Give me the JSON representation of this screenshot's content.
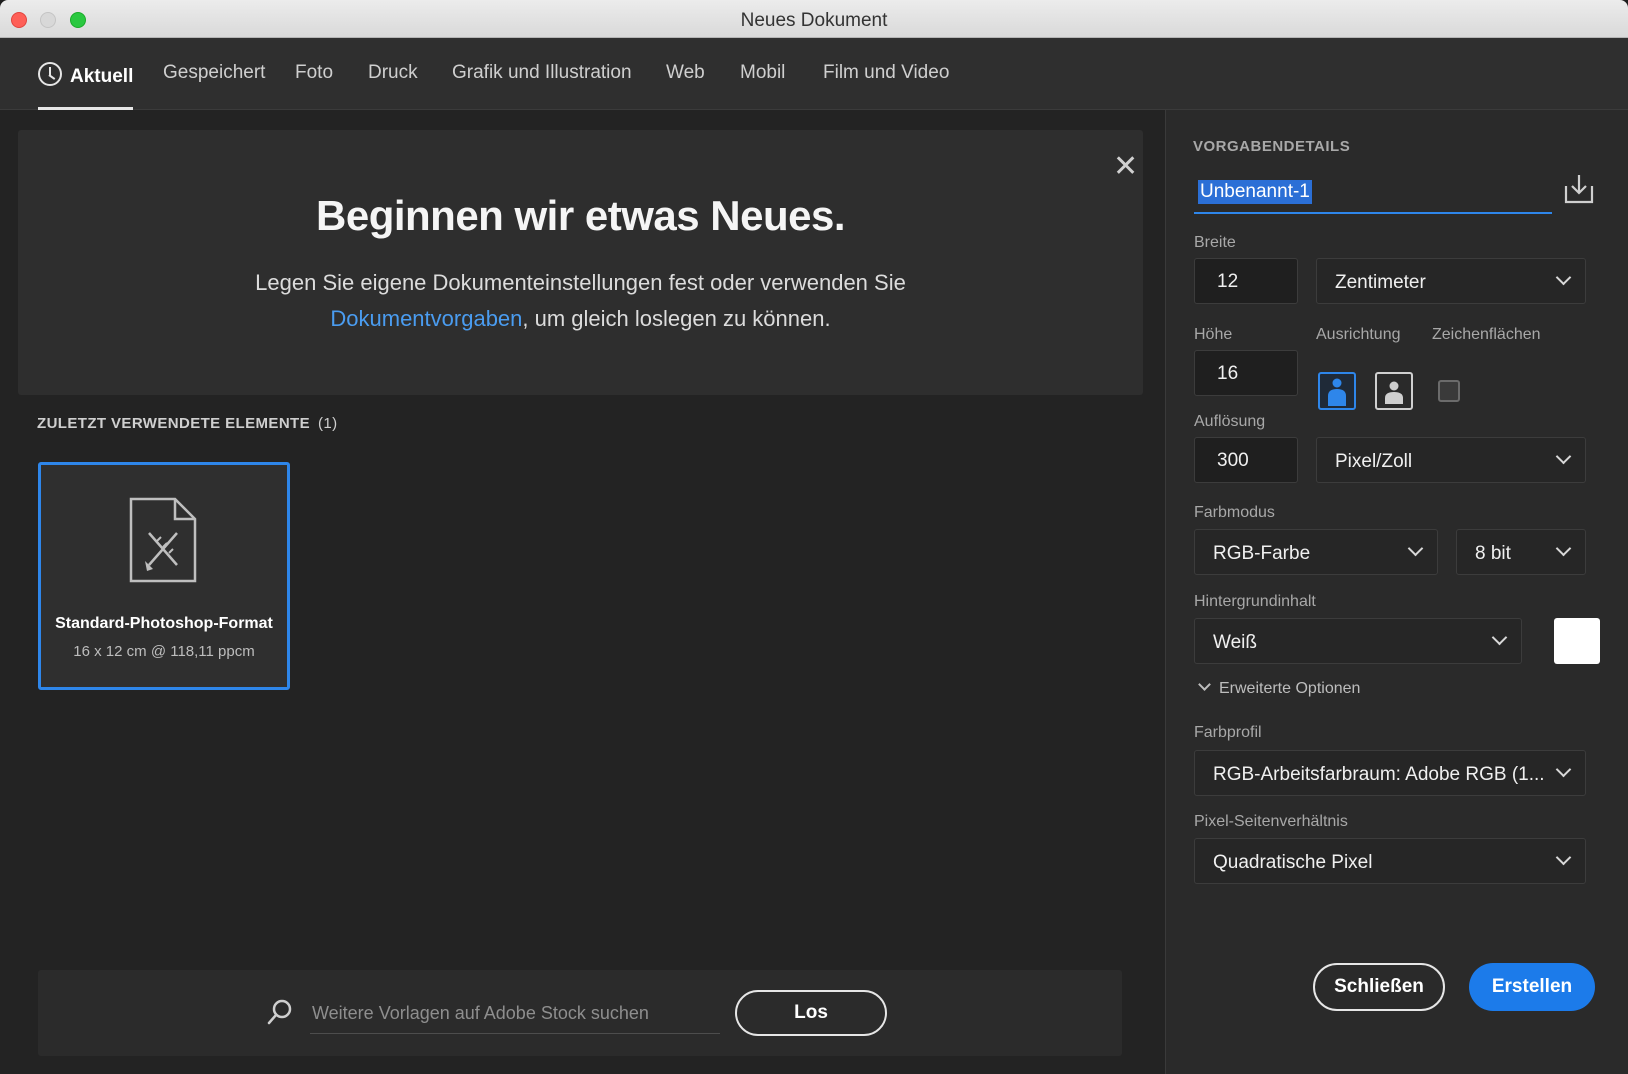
{
  "window": {
    "title": "Neues Dokument"
  },
  "tabs": [
    {
      "label": "Aktuell",
      "active": true
    },
    {
      "label": "Gespeichert"
    },
    {
      "label": "Foto"
    },
    {
      "label": "Druck"
    },
    {
      "label": "Grafik und Illustration"
    },
    {
      "label": "Web"
    },
    {
      "label": "Mobil"
    },
    {
      "label": "Film und Video"
    }
  ],
  "hero": {
    "title": "Beginnen wir etwas Neues.",
    "text_before": "Legen Sie eigene Dokumenteinstellungen fest oder verwenden Sie",
    "link": "Dokumentvorgaben",
    "text_after": ", um gleich loslegen zu können."
  },
  "recent": {
    "heading": "ZULETZT VERWENDETE ELEMENTE",
    "count": "(1)",
    "items": [
      {
        "title": "Standard-Photoshop-Format",
        "subtitle": "16 x 12 cm @ 118,11 ppcm"
      }
    ]
  },
  "stock": {
    "placeholder": "Weitere Vorlagen auf Adobe Stock suchen",
    "go_label": "Los"
  },
  "details": {
    "section_title": "VORGABENDETAILS",
    "name": "Unbenannt-1",
    "width_label": "Breite",
    "width_value": "12",
    "width_unit": "Zentimeter",
    "height_label": "Höhe",
    "height_value": "16",
    "orientation_label": "Ausrichtung",
    "artboards_label": "Zeichenflächen",
    "resolution_label": "Auflösung",
    "resolution_value": "300",
    "resolution_unit": "Pixel/Zoll",
    "color_mode_label": "Farbmodus",
    "color_mode": "RGB-Farbe",
    "bit_depth": "8 bit",
    "background_label": "Hintergrundinhalt",
    "background_value": "Weiß",
    "background_color": "#ffffff",
    "advanced_label": "Erweiterte Optionen",
    "profile_label": "Farbprofil",
    "profile_value": "RGB-Arbeitsfarbraum: Adobe RGB (1...",
    "pixel_ratio_label": "Pixel-Seitenverhältnis",
    "pixel_ratio_value": "Quadratische Pixel"
  },
  "actions": {
    "close_label": "Schließen",
    "create_label": "Erstellen"
  },
  "colors": {
    "accent": "#2e86ea",
    "primary_button": "#1c7bea",
    "link": "#4a9cf0"
  }
}
